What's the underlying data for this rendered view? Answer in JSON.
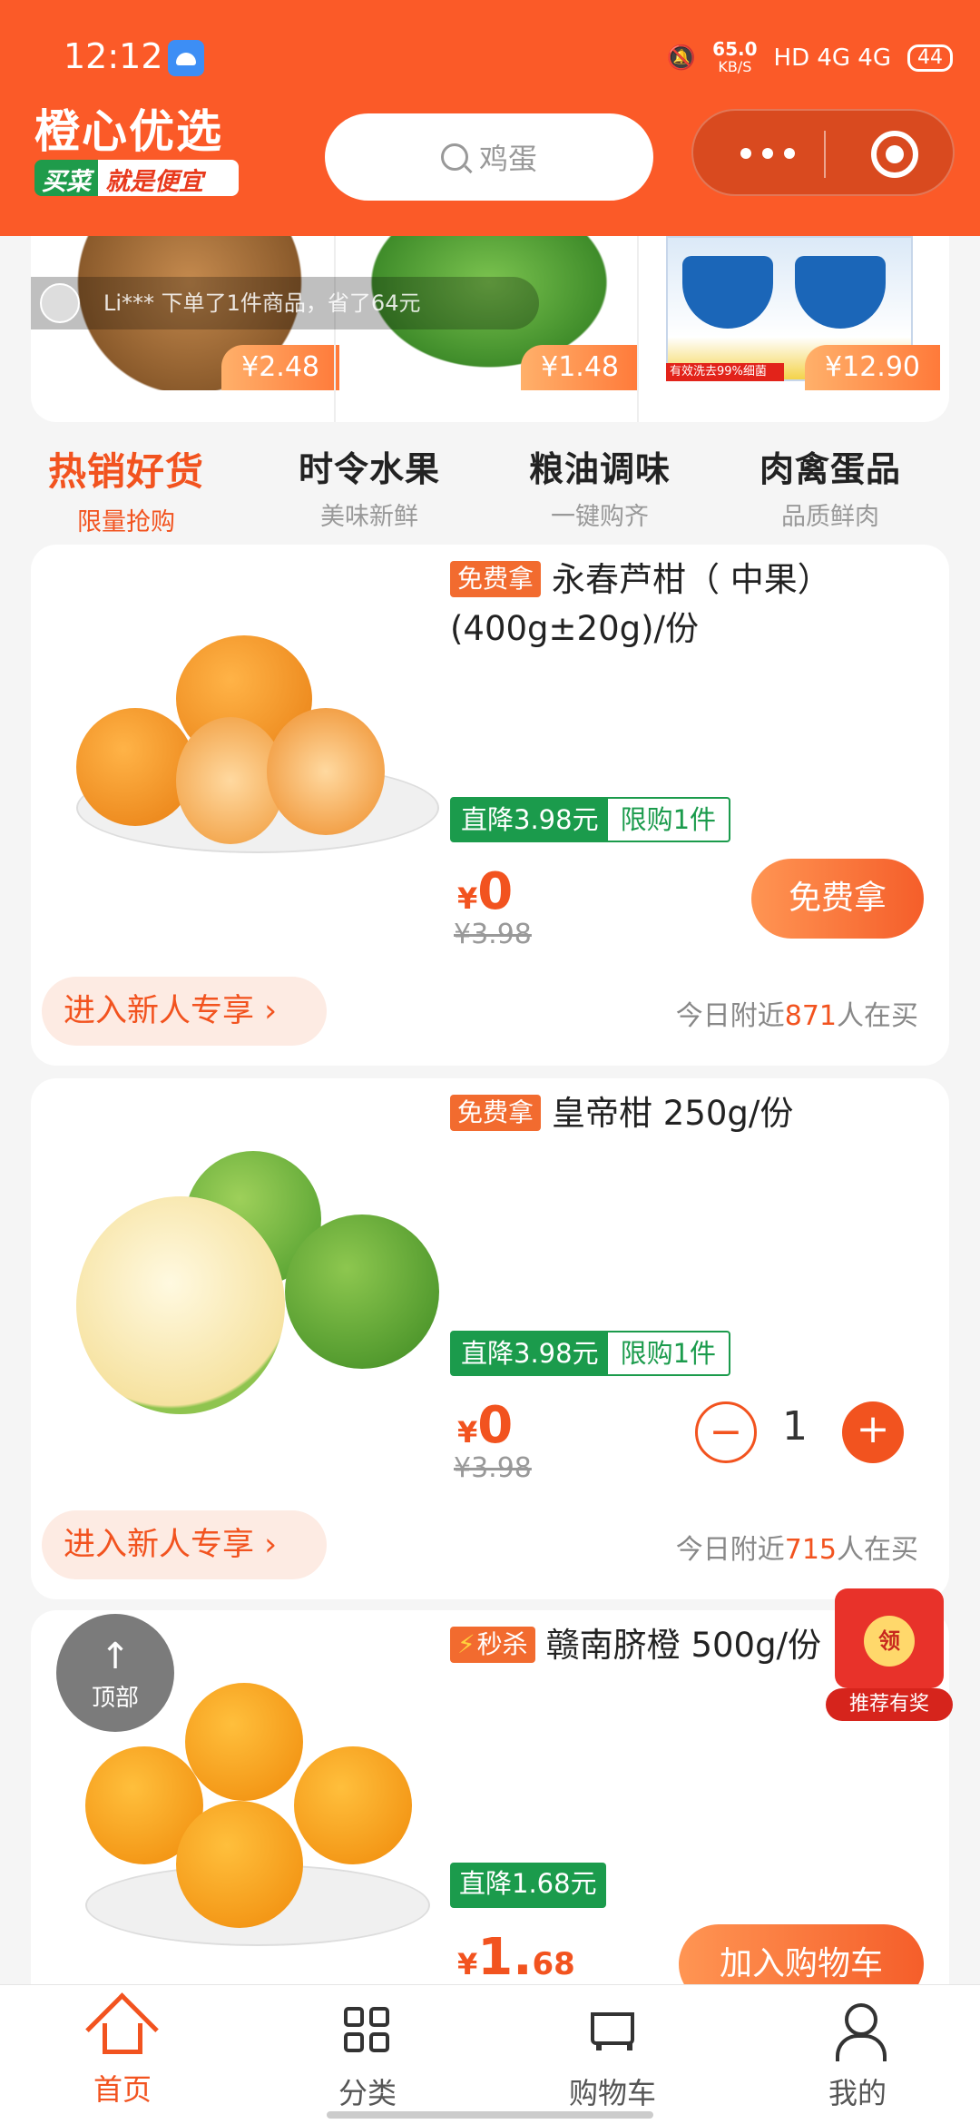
{
  "status": {
    "time": "12:12",
    "speed": "65.0",
    "speed_unit": "KB/S",
    "network": "HD 4G 4G",
    "battery": "44"
  },
  "header": {
    "logo_title": "橙心优选",
    "logo_sub_a": "买菜",
    "logo_sub_b": "就是便宜",
    "search_placeholder": "鸡蛋"
  },
  "deals": {
    "ticker": "Li*** 下单了1件商品，省了64元",
    "items": [
      {
        "name": "ginger",
        "price": "¥2.48"
      },
      {
        "name": "bok-choy",
        "price": "¥1.48"
      },
      {
        "name": "safeguard-soap",
        "price": "¥12.90",
        "tag": "有效洗去99%细菌"
      }
    ]
  },
  "tabs": [
    {
      "title": "热销好货",
      "sub": "限量抢购"
    },
    {
      "title": "时令水果",
      "sub": "美味新鲜"
    },
    {
      "title": "粮油调味",
      "sub": "一键购齐"
    },
    {
      "title": "肉禽蛋品",
      "sub": "品质鲜肉"
    }
  ],
  "products": [
    {
      "badge": "免费拿",
      "title": "永春芦柑（ 中果）(400g±20g)/份",
      "promo_discount": "直降3.98元",
      "promo_limit": "限购1件",
      "price_symbol": "¥",
      "price_int": "0",
      "price_dec": "",
      "old_price": "¥3.98",
      "action": "免费拿",
      "newbie": "进入新人专享",
      "buying_prefix": "今日附近",
      "buying_count": "871",
      "buying_suffix": "人在买"
    },
    {
      "badge": "免费拿",
      "title": "皇帝柑 250g/份",
      "promo_discount": "直降3.98元",
      "promo_limit": "限购1件",
      "price_symbol": "¥",
      "price_int": "0",
      "price_dec": "",
      "old_price": "¥3.98",
      "quantity": "1",
      "newbie": "进入新人专享",
      "buying_prefix": "今日附近",
      "buying_count": "715",
      "buying_suffix": "人在买"
    },
    {
      "badge": "秒杀",
      "title": "赣南脐橙 500g/份",
      "promo_discount": "直降1.68元",
      "price_symbol": "¥",
      "price_int": "1.",
      "price_dec": "68",
      "action": "加入购物车"
    }
  ],
  "floating": {
    "top_label": "顶部",
    "top_arrow": "↑",
    "redpack_coin": "领",
    "redpack_label": "推荐有奖"
  },
  "nav": [
    {
      "label": "首页",
      "icon": "home-icon"
    },
    {
      "label": "分类",
      "icon": "category-icon"
    },
    {
      "label": "购物车",
      "icon": "cart-icon"
    },
    {
      "label": "我的",
      "icon": "profile-icon"
    }
  ],
  "colors": {
    "brand": "#fb5a28",
    "accent": "#f2531f",
    "promo_green": "#1b9b4c"
  }
}
